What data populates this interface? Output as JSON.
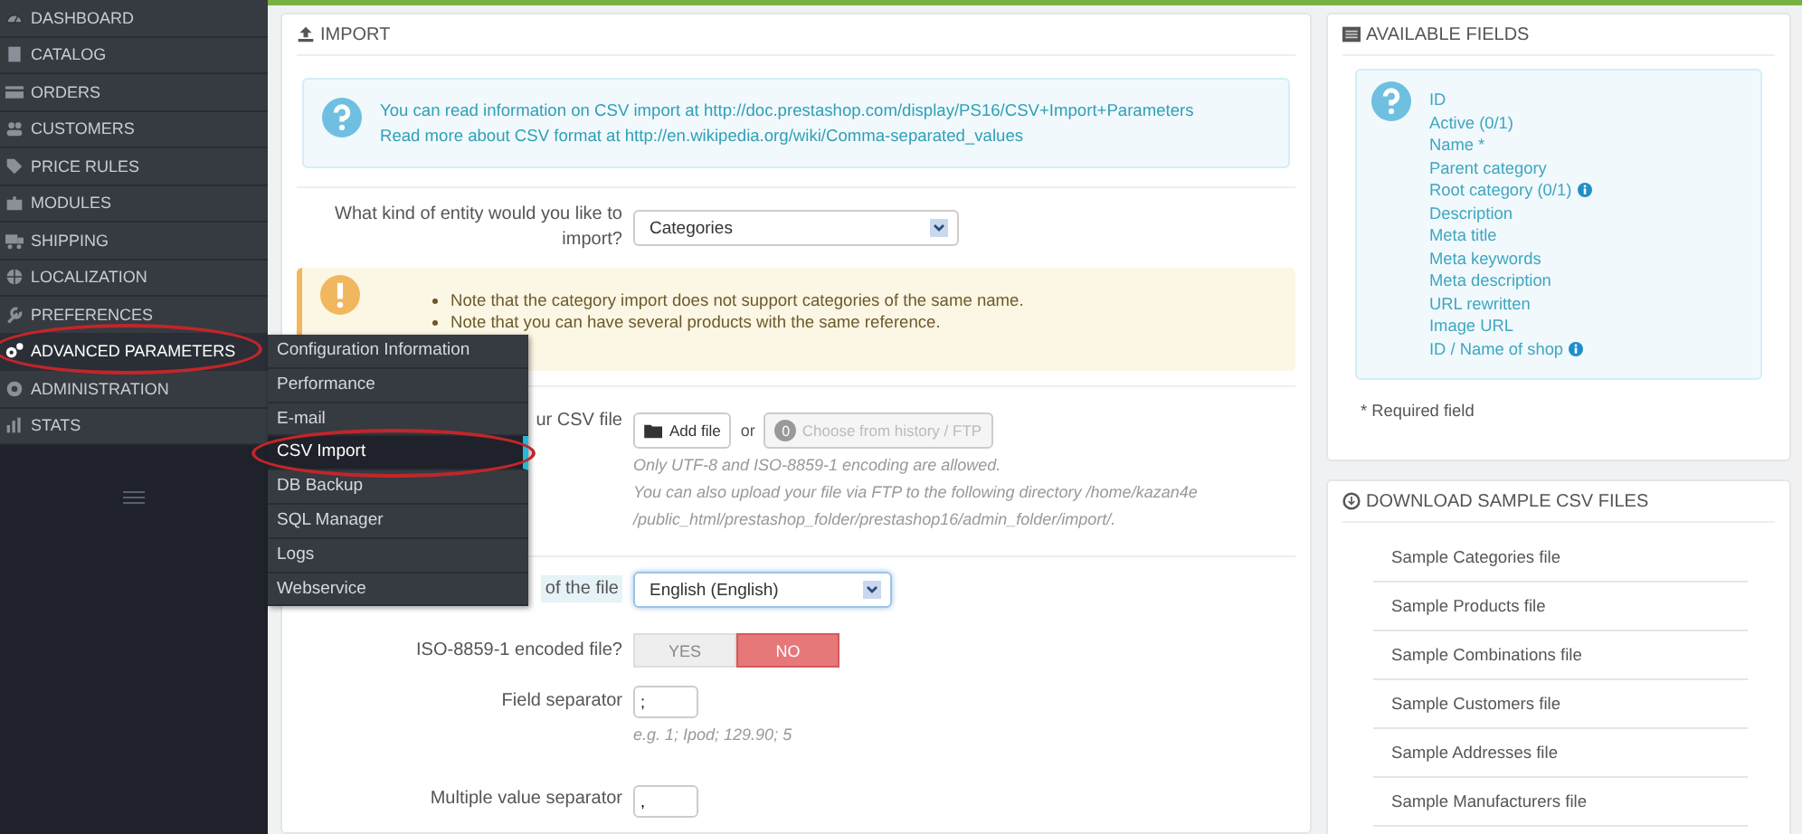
{
  "sidebar": {
    "items": [
      {
        "label": "DASHBOARD",
        "selected": false
      },
      {
        "label": "CATALOG",
        "selected": false
      },
      {
        "label": "ORDERS",
        "selected": false
      },
      {
        "label": "CUSTOMERS",
        "selected": false
      },
      {
        "label": "PRICE RULES",
        "selected": false
      },
      {
        "label": "MODULES",
        "selected": false
      },
      {
        "label": "SHIPPING",
        "selected": false
      },
      {
        "label": "LOCALIZATION",
        "selected": false
      },
      {
        "label": "PREFERENCES",
        "selected": false
      },
      {
        "label": "ADVANCED PARAMETERS",
        "selected": true
      },
      {
        "label": "ADMINISTRATION",
        "selected": false
      },
      {
        "label": "STATS",
        "selected": false
      }
    ]
  },
  "submenu": {
    "items": [
      {
        "label": "Configuration Information",
        "selected": false
      },
      {
        "label": "Performance",
        "selected": false
      },
      {
        "label": "E-mail",
        "selected": false
      },
      {
        "label": "CSV Import",
        "selected": true
      },
      {
        "label": "DB Backup",
        "selected": false
      },
      {
        "label": "SQL Manager",
        "selected": false
      },
      {
        "label": "Logs",
        "selected": false
      },
      {
        "label": "Webservice",
        "selected": false
      }
    ]
  },
  "import_panel": {
    "title": "IMPORT",
    "info": [
      "You can read information on CSV import at http://doc.prestashop.com/display/PS16/CSV+Import+Parameters",
      "Read more about CSV format at http://en.wikipedia.org/wiki/Comma-separated_values"
    ],
    "entity": {
      "label": "What kind of entity would you like to import?",
      "value": "Categories"
    },
    "warnings": [
      "Note that the category import does not support categories of the same name.",
      "Note that you can have several products with the same reference."
    ],
    "file": {
      "label": "ur CSV file",
      "add_button": "Add file",
      "or": "or",
      "history_count": "0",
      "history_button": "Choose from history / FTP",
      "help": [
        "Only UTF-8 and ISO-8859-1 encoding are allowed.",
        "You can also upload your file via FTP to the following directory /home/kazan4e",
        "/public_html/prestashop_folder/prestashop16/admin_folder/import/."
      ]
    },
    "language": {
      "label": "of the file",
      "value": "English (English)"
    },
    "iso": {
      "label": "ISO-8859-1 encoded file?",
      "options": [
        {
          "label": "YES",
          "selected": false
        },
        {
          "label": "NO",
          "selected": true
        }
      ]
    },
    "field_separator": {
      "label": "Field separator",
      "value": ";",
      "hint": "e.g. 1; Ipod; 129.90; 5"
    },
    "multiple_separator": {
      "label": "Multiple value separator",
      "value": ","
    }
  },
  "fields_panel": {
    "title": "AVAILABLE FIELDS",
    "fields": [
      {
        "label": "ID",
        "info": false
      },
      {
        "label": "Active (0/1)",
        "info": false
      },
      {
        "label": "Name *",
        "info": false
      },
      {
        "label": "Parent category",
        "info": false
      },
      {
        "label": "Root category (0/1)",
        "info": true
      },
      {
        "label": "Description",
        "info": false
      },
      {
        "label": "Meta title",
        "info": false
      },
      {
        "label": "Meta keywords",
        "info": false
      },
      {
        "label": "Meta description",
        "info": false
      },
      {
        "label": "URL rewritten",
        "info": false
      },
      {
        "label": "Image URL",
        "info": false
      },
      {
        "label": "ID / Name of shop",
        "info": true
      }
    ],
    "note": "* Required field"
  },
  "samples_panel": {
    "title": "DOWNLOAD SAMPLE CSV FILES",
    "files": [
      "Sample Categories file",
      "Sample Products file",
      "Sample Combinations file",
      "Sample Customers file",
      "Sample Addresses file",
      "Sample Manufacturers file"
    ]
  }
}
